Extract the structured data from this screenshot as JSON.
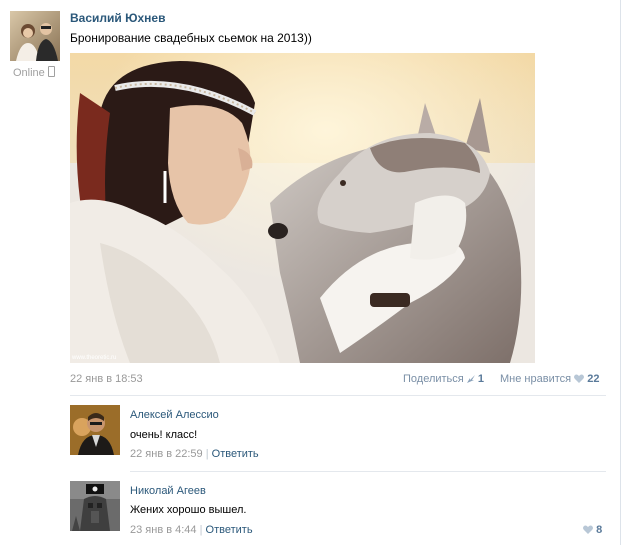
{
  "post": {
    "author": "Василий Юхнев",
    "status": "Online",
    "text": "Бронирование свадебных сьемок на 2013))",
    "photo_watermark": "www.theoretic.ru",
    "date": "22 янв в 18:53",
    "share_label": "Поделиться",
    "share_count": "1",
    "like_label": "Мне нравится",
    "like_count": "22"
  },
  "comments": [
    {
      "author": "Алексей Алессио",
      "text": "очень! класс!",
      "date": "22 янв в 22:59",
      "separator": "|",
      "reply_label": "Ответить",
      "like_count": ""
    },
    {
      "author": "Николай Агеев",
      "text": "Жених хорошо вышел.",
      "date": "23 янв в 4:44",
      "separator": "|",
      "reply_label": "Ответить",
      "like_count": "8"
    }
  ],
  "colors": {
    "link": "#2b587a",
    "muted": "#999999",
    "accent_heart": "#b8c7d6"
  }
}
